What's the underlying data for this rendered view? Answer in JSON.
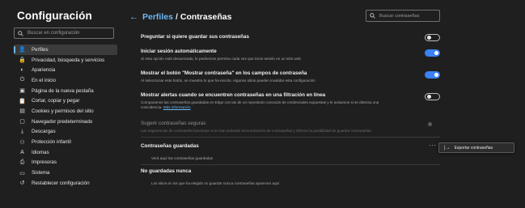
{
  "sidebar": {
    "title": "Configuración",
    "search_placeholder": "Buscar en configuración",
    "items": [
      {
        "label": "Perfiles",
        "icon": "profile-icon",
        "glyph": "👤",
        "active": true
      },
      {
        "label": "Privacidad, búsqueda y servicios",
        "icon": "lock-icon",
        "glyph": "🔒"
      },
      {
        "label": "Apariencia",
        "icon": "palette-icon",
        "glyph": "◐"
      },
      {
        "label": "En el inicio",
        "icon": "power-icon",
        "glyph": "⏻"
      },
      {
        "label": "Página de la nueva pestaña",
        "icon": "new-tab-icon",
        "glyph": "▣"
      },
      {
        "label": "Cortar, copiar y pegar",
        "icon": "clipboard-icon",
        "glyph": "📋"
      },
      {
        "label": "Cookies y permisos del sitio",
        "icon": "cookie-icon",
        "glyph": "▤"
      },
      {
        "label": "Navegador predeterminado",
        "icon": "browser-icon",
        "glyph": "▢"
      },
      {
        "label": "Descargas",
        "icon": "download-icon",
        "glyph": "⤓"
      },
      {
        "label": "Protección infantil",
        "icon": "family-icon",
        "glyph": "⚇"
      },
      {
        "label": "Idiomas",
        "icon": "language-icon",
        "glyph": "A"
      },
      {
        "label": "Impresoras",
        "icon": "printer-icon",
        "glyph": "⎙"
      },
      {
        "label": "Sistema",
        "icon": "system-icon",
        "glyph": "▭"
      },
      {
        "label": "Restablecer configuración",
        "icon": "reset-icon",
        "glyph": "↺"
      }
    ]
  },
  "header": {
    "back_glyph": "←",
    "link": "Perfiles",
    "separator": "/",
    "current": "Contraseñas",
    "search_placeholder": "Buscar contraseñas"
  },
  "settings": [
    {
      "title": "Preguntar si quiere guardar sus contraseñas",
      "desc": "",
      "state": "off"
    },
    {
      "title": "Iniciar sesión automáticamente",
      "desc": "Si esta opción está desactivada, le pediremos permiso cada vez que inicie sesión en un sitio web",
      "state": "on"
    },
    {
      "title": "Mostrar el botón \"Mostrar contraseña\" en los campos de contraseña",
      "desc": "Al seleccionar este botón, se muestra lo que ha escrito. Algunos sitios pueden invalidar esta configuración",
      "state": "on"
    },
    {
      "title": "Mostrar alertas cuando se encuentren contraseñas en una filtración en línea",
      "desc": "Comparamos las contraseñas guardadas en Edge con las de un repositorio conocido de credenciales expuestas y le avisamos si se detecta una",
      "desc2": "coincidencia.",
      "link": "Más información",
      "state": "off"
    },
    {
      "title": "Sugerir contraseñas seguras",
      "desc": "Las sugerencias de contraseña funcionan si se han activado Sincronización de contraseñas y Ofrecer la posibilidad de guardar contraseñas",
      "state": "disabled"
    }
  ],
  "saved": {
    "title": "Contraseñas guardadas",
    "note": "Verá aquí las contraseñas guardadas",
    "more_glyph": "···",
    "menu_icon_glyph": "|→",
    "menu_item": "Exportar contraseñas"
  },
  "never": {
    "title": "No guardadas nunca",
    "note": "Los sitios en los que ha elegido no guardar nunca contraseñas aparecen aquí"
  },
  "colors": {
    "accent": "#6cb8f6",
    "toggle_on": "#3b82f6",
    "background": "#1f1f1f"
  }
}
